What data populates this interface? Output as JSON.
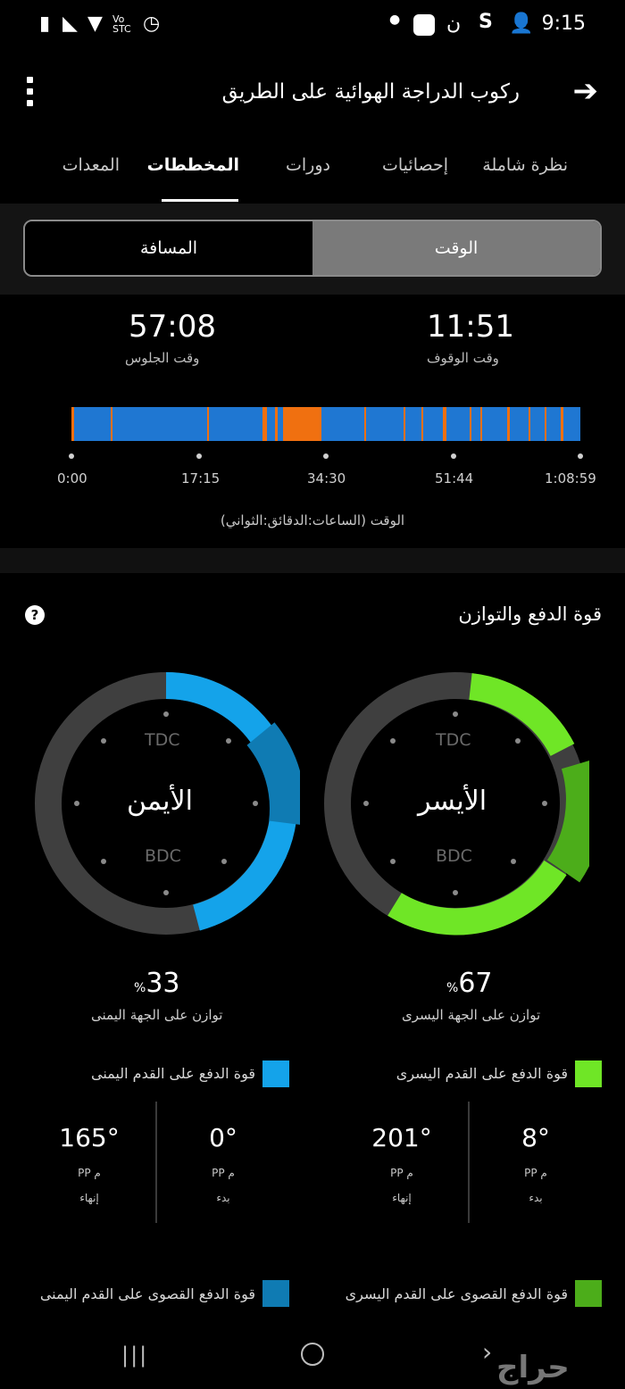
{
  "status_bar": {
    "time": "9:15"
  },
  "header": {
    "title": "ركوب الدراجة الهوائية على الطريق"
  },
  "tabs": [
    {
      "label": "نظرة شاملة"
    },
    {
      "label": "إحصائيات"
    },
    {
      "label": "دورات"
    },
    {
      "label": "المخططات",
      "active": true
    },
    {
      "label": "المعدات"
    }
  ],
  "toggle": {
    "time_label": "الوقت",
    "distance_label": "المسافة",
    "selected": "time"
  },
  "stats": {
    "standing_value": "11:51",
    "standing_label": "وقت الوقوف",
    "seated_value": "57:08",
    "seated_label": "وقت الجلوس"
  },
  "timeline": {
    "ticks": [
      "0:00",
      "17:15",
      "34:30",
      "51:44",
      "1:08:59"
    ],
    "axis_label": "الوقت (الساعات:الدقائق:الثواني)",
    "colors": {
      "seated": "#1f77d2",
      "standing": "#f07010"
    }
  },
  "power_phase": {
    "title": "قوة الدفع والتوازن",
    "left": {
      "name": "الأيسر",
      "tdc": "TDC",
      "bdc": "BDC",
      "balance_value": "67",
      "balance_unit": "%",
      "balance_label": "توازن على الجهة اليسرى",
      "color": "#6fe626",
      "peak_color": "#4cad1a"
    },
    "right": {
      "name": "الأيمن",
      "tdc": "TDC",
      "bdc": "BDC",
      "balance_value": "33",
      "balance_unit": "%",
      "balance_label": "توازن على الجهة اليمنى",
      "color": "#14a3ea",
      "peak_color": "#0f7bb3"
    },
    "left_legend": "قوة الدفع على القدم اليسرى",
    "right_legend": "قوة الدفع على القدم اليمنى",
    "left_start": {
      "value": "8°",
      "unit": "م PP",
      "label": "بدء"
    },
    "left_end": {
      "value": "201°",
      "unit": "م PP",
      "label": "إنهاء"
    },
    "right_start": {
      "value": "0°",
      "unit": "م PP",
      "label": "بدء"
    },
    "right_end": {
      "value": "165°",
      "unit": "م PP",
      "label": "إنهاء"
    },
    "left_peak_legend": "قوة الدفع القصوى على القدم اليسرى",
    "right_peak_legend": "قوة الدفع القصوى على القدم اليمنى"
  },
  "watermark": "حراج"
}
